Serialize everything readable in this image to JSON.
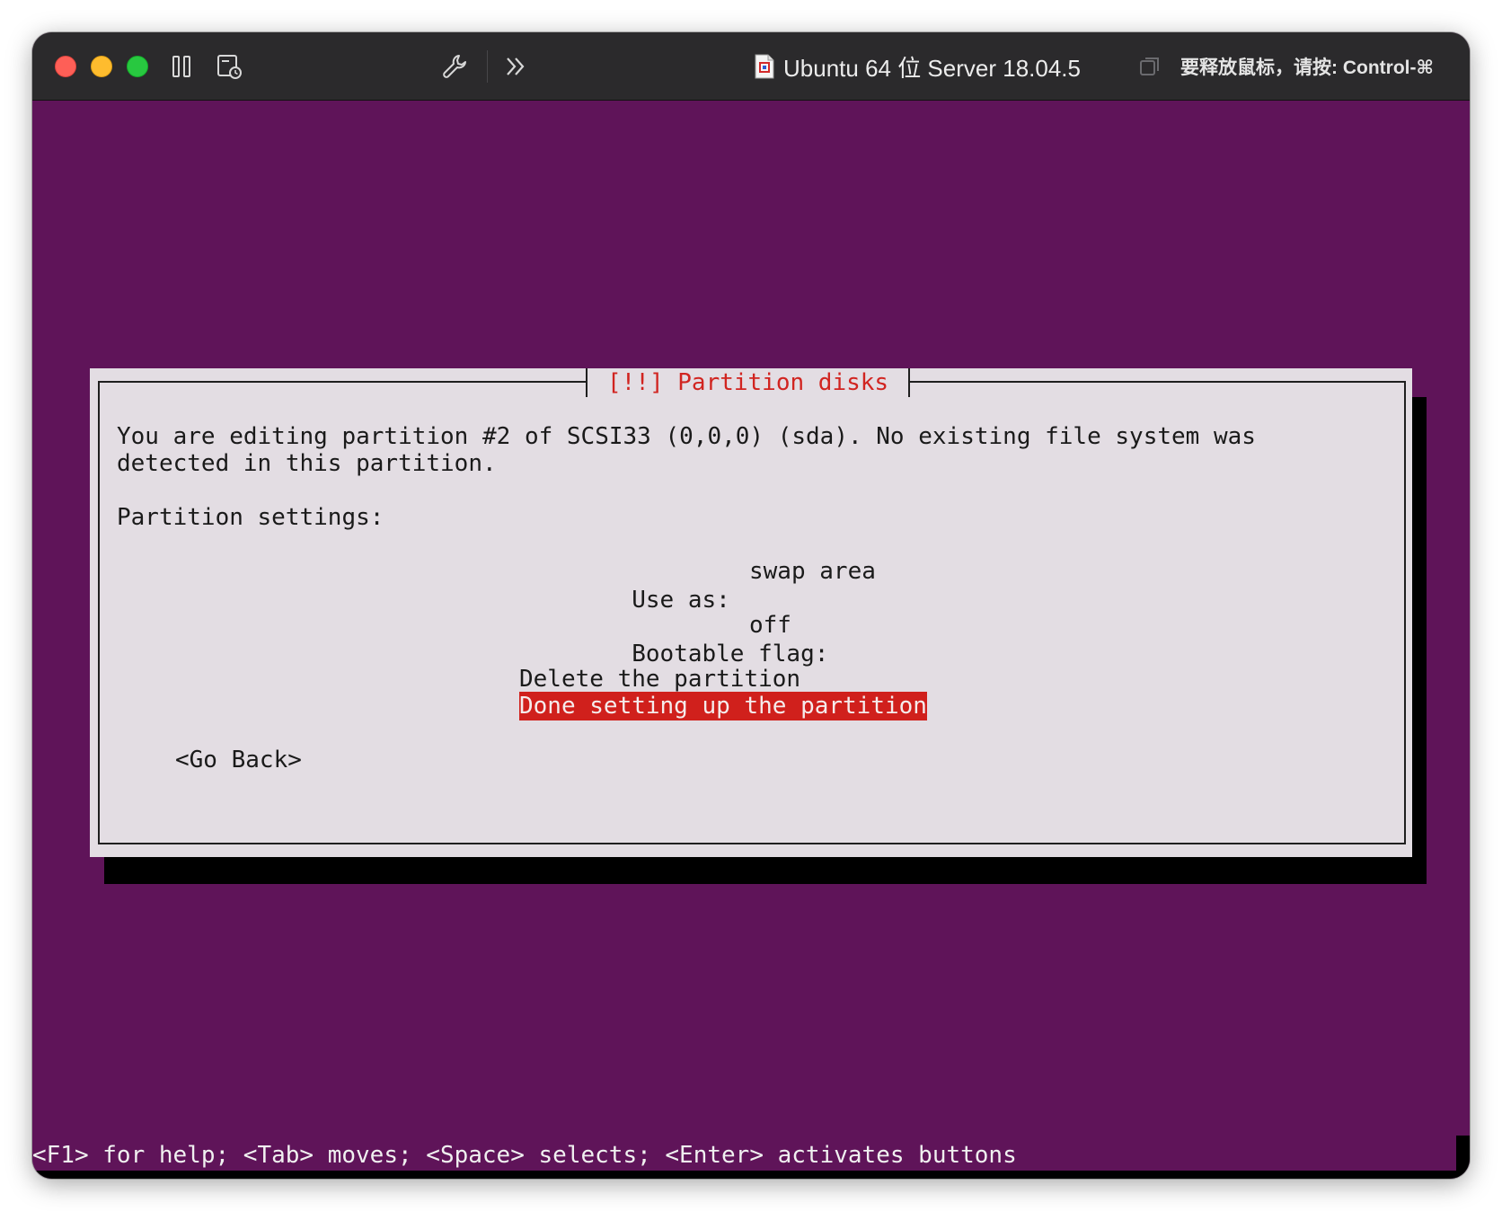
{
  "window": {
    "title": "Ubuntu 64 位 Server 18.04.5",
    "release_hint": "要释放鼠标，请按: Control-⌘"
  },
  "toolbar": {
    "icons": [
      "pause-icon",
      "snapshot-icon",
      "settings-wrench-icon",
      "more-chevron-icon",
      "document-icon",
      "window-toggle-icon"
    ]
  },
  "dialog": {
    "title": "[!!] Partition disks",
    "description_line1": "You are editing partition #2 of SCSI33 (0,0,0) (sda). No existing file system was",
    "description_line2": "detected in this partition.",
    "settings_heading": "Partition settings:",
    "settings": [
      {
        "label": "Use as:",
        "value": "swap area"
      },
      {
        "label": "Bootable flag:",
        "value": "off"
      }
    ],
    "actions": {
      "delete": "Delete the partition",
      "done": "Done setting up the partition"
    },
    "go_back": "<Go Back>"
  },
  "statusbar": {
    "help": "<F1> for help; <Tab> moves; <Space> selects; <Enter> activates buttons"
  },
  "colors": {
    "console_bg": "#5f1459",
    "dialog_bg": "#e3dde3",
    "accent_red": "#d0201c",
    "titlebar_bg": "#2b2a2c"
  }
}
